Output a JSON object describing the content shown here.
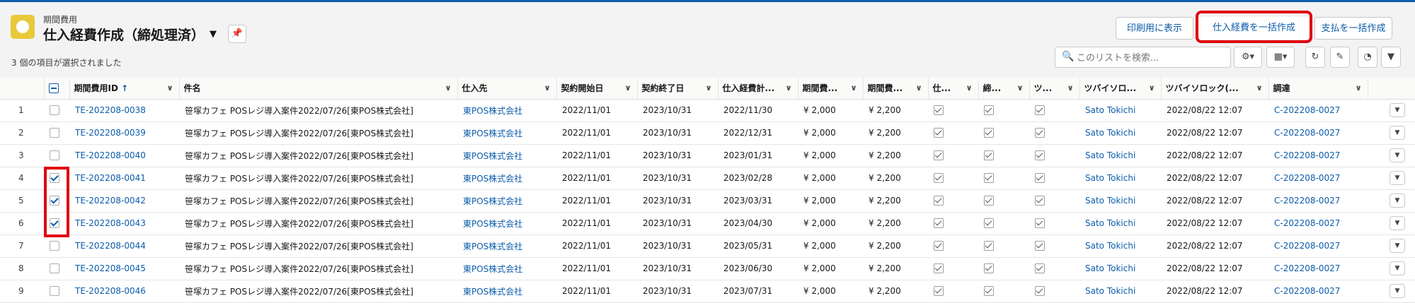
{
  "header": {
    "object_label": "期間費用",
    "title": "仕入経費作成（締処理済）",
    "selection_status": "3 個の項目が選択されました"
  },
  "actions": {
    "print_label": "印刷用に表示",
    "bulk_create_label": "仕入経費を一括作成",
    "bulk_payment_label": "支払を一括作成"
  },
  "search": {
    "placeholder": "このリストを検索..."
  },
  "columns": {
    "id": "期間費用ID",
    "subject": "件名",
    "supplier": "仕入先",
    "start": "契約開始日",
    "end": "契約終了日",
    "plan": "仕入経費計...",
    "fee1": "期間費...",
    "fee2": "期間費...",
    "f1": "仕...",
    "f2": "締...",
    "f3": "ツ...",
    "user": "ツバイソロ...",
    "lock": "ツバイソロック(...",
    "proc": "調達"
  },
  "rows": [
    {
      "num": "1",
      "id": "TE-202208-0038",
      "subject": "笹塚カフェ POSレジ導入案件2022/07/26[東POS株式会社]",
      "supplier": "東POS株式会社",
      "start": "2022/11/01",
      "end": "2023/10/31",
      "plan": "2022/11/30",
      "fee1": "¥ 2,000",
      "fee2": "¥ 2,200",
      "user": "Sato Tokichi",
      "lock": "2022/08/22 12:07",
      "proc": "C-202208-0027",
      "selected": false
    },
    {
      "num": "2",
      "id": "TE-202208-0039",
      "subject": "笹塚カフェ POSレジ導入案件2022/07/26[東POS株式会社]",
      "supplier": "東POS株式会社",
      "start": "2022/11/01",
      "end": "2023/10/31",
      "plan": "2022/12/31",
      "fee1": "¥ 2,000",
      "fee2": "¥ 2,200",
      "user": "Sato Tokichi",
      "lock": "2022/08/22 12:07",
      "proc": "C-202208-0027",
      "selected": false
    },
    {
      "num": "3",
      "id": "TE-202208-0040",
      "subject": "笹塚カフェ POSレジ導入案件2022/07/26[東POS株式会社]",
      "supplier": "東POS株式会社",
      "start": "2022/11/01",
      "end": "2023/10/31",
      "plan": "2023/01/31",
      "fee1": "¥ 2,000",
      "fee2": "¥ 2,200",
      "user": "Sato Tokichi",
      "lock": "2022/08/22 12:07",
      "proc": "C-202208-0027",
      "selected": false
    },
    {
      "num": "4",
      "id": "TE-202208-0041",
      "subject": "笹塚カフェ POSレジ導入案件2022/07/26[東POS株式会社]",
      "supplier": "東POS株式会社",
      "start": "2022/11/01",
      "end": "2023/10/31",
      "plan": "2023/02/28",
      "fee1": "¥ 2,000",
      "fee2": "¥ 2,200",
      "user": "Sato Tokichi",
      "lock": "2022/08/22 12:07",
      "proc": "C-202208-0027",
      "selected": true
    },
    {
      "num": "5",
      "id": "TE-202208-0042",
      "subject": "笹塚カフェ POSレジ導入案件2022/07/26[東POS株式会社]",
      "supplier": "東POS株式会社",
      "start": "2022/11/01",
      "end": "2023/10/31",
      "plan": "2023/03/31",
      "fee1": "¥ 2,000",
      "fee2": "¥ 2,200",
      "user": "Sato Tokichi",
      "lock": "2022/08/22 12:07",
      "proc": "C-202208-0027",
      "selected": true
    },
    {
      "num": "6",
      "id": "TE-202208-0043",
      "subject": "笹塚カフェ POSレジ導入案件2022/07/26[東POS株式会社]",
      "supplier": "東POS株式会社",
      "start": "2022/11/01",
      "end": "2023/10/31",
      "plan": "2023/04/30",
      "fee1": "¥ 2,000",
      "fee2": "¥ 2,200",
      "user": "Sato Tokichi",
      "lock": "2022/08/22 12:07",
      "proc": "C-202208-0027",
      "selected": true
    },
    {
      "num": "7",
      "id": "TE-202208-0044",
      "subject": "笹塚カフェ POSレジ導入案件2022/07/26[東POS株式会社]",
      "supplier": "東POS株式会社",
      "start": "2022/11/01",
      "end": "2023/10/31",
      "plan": "2023/05/31",
      "fee1": "¥ 2,000",
      "fee2": "¥ 2,200",
      "user": "Sato Tokichi",
      "lock": "2022/08/22 12:07",
      "proc": "C-202208-0027",
      "selected": false
    },
    {
      "num": "8",
      "id": "TE-202208-0045",
      "subject": "笹塚カフェ POSレジ導入案件2022/07/26[東POS株式会社]",
      "supplier": "東POS株式会社",
      "start": "2022/11/01",
      "end": "2023/10/31",
      "plan": "2023/06/30",
      "fee1": "¥ 2,000",
      "fee2": "¥ 2,200",
      "user": "Sato Tokichi",
      "lock": "2022/08/22 12:07",
      "proc": "C-202208-0027",
      "selected": false
    },
    {
      "num": "9",
      "id": "TE-202208-0046",
      "subject": "笹塚カフェ POSレジ導入案件2022/07/26[東POS株式会社]",
      "supplier": "東POS株式会社",
      "start": "2022/11/01",
      "end": "2023/10/31",
      "plan": "2023/07/31",
      "fee1": "¥ 2,000",
      "fee2": "¥ 2,200",
      "user": "Sato Tokichi",
      "lock": "2022/08/22 12:07",
      "proc": "C-202208-0027",
      "selected": false
    }
  ],
  "colors": {
    "accent": "#0b5cab",
    "highlight": "#e0000f",
    "object_icon": "#e8c93a"
  },
  "icons": [
    "object-icon",
    "pin-icon",
    "search-icon",
    "gear-icon",
    "table-icon",
    "refresh-icon",
    "edit-icon",
    "chart-icon",
    "filter-icon",
    "sort-up-icon",
    "chevron-down-icon"
  ]
}
